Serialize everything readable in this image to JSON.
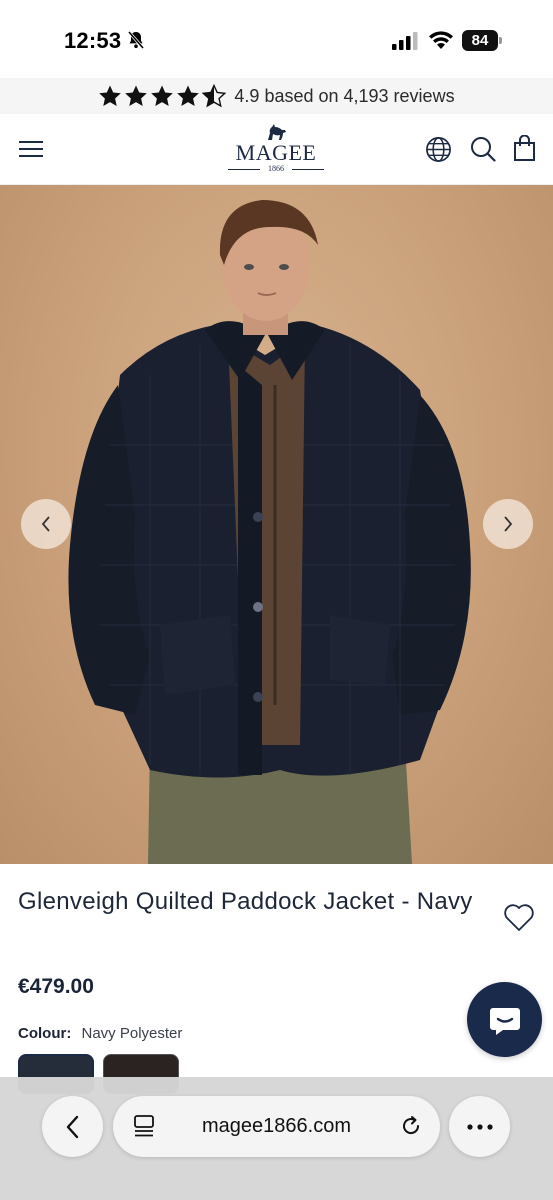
{
  "status_bar": {
    "time": "12:53",
    "battery": "84"
  },
  "reviews": {
    "rating_stars": 4.5,
    "text": "4.9 based on 4,193 reviews"
  },
  "header": {
    "logo_name": "MAGEE",
    "logo_year": "1866",
    "brand_color": "#1d2a44"
  },
  "product": {
    "image_description_icon": "jacket-photo",
    "title": "Glenveigh Quilted Paddock Jacket - Navy",
    "price": "€479.00",
    "colour_label": "Colour:",
    "colour_value": "Navy Polyester",
    "swatches": [
      "#252d3b",
      "#2a2322"
    ]
  },
  "chat": {
    "icon": "chat-bubble-icon",
    "color": "#192a4b"
  },
  "browser": {
    "url": "magee1866.com"
  }
}
